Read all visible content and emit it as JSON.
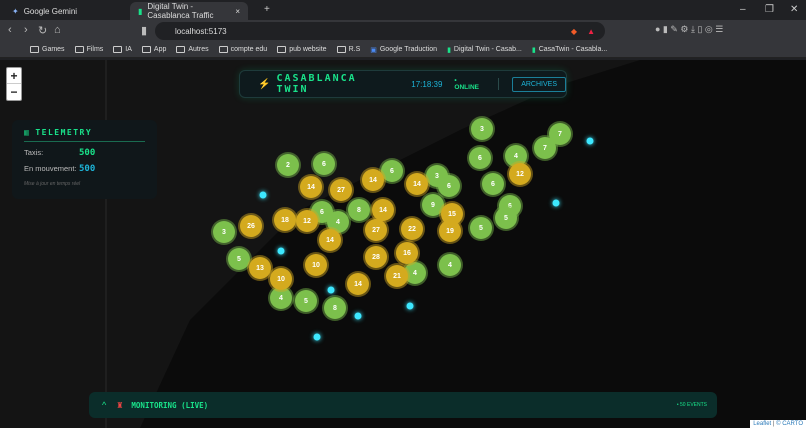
{
  "browser": {
    "tabs": [
      {
        "label": "Google Gemini"
      },
      {
        "label": "Digital Twin - Casablanca Traffic"
      }
    ],
    "url": "localhost:5173",
    "bookmarks": [
      "Games",
      "Films",
      "IA",
      "App",
      "Autres",
      "compte edu",
      "pub website",
      "R.S",
      "Google Traduction",
      "Digital Twin - Casab...",
      "CasaTwin - Casabla..."
    ]
  },
  "header": {
    "title": "CASABLANCA TWIN",
    "time": "17:18:39",
    "status": "• ONLINE",
    "archives": "ARCHIVES"
  },
  "zoom": {
    "in": "+",
    "out": "−"
  },
  "telemetry": {
    "title": "TELEMETRY",
    "taxis_label": "Taxis:",
    "taxis": "500",
    "moving_label": "En mouvement:",
    "moving": "500",
    "note": "Mise à jour en temps réel"
  },
  "clusters": {
    "green": [
      "3",
      "7",
      "7",
      "2",
      "6",
      "6",
      "4",
      "6",
      "3",
      "6",
      "6",
      "9",
      "6",
      "5",
      "5",
      "8",
      "6",
      "4",
      "3",
      "5",
      "4",
      "4",
      "4",
      "5",
      "8"
    ],
    "yellow": [
      "14",
      "27",
      "14",
      "14",
      "12",
      "14",
      "18",
      "12",
      "26",
      "14",
      "27",
      "22",
      "15",
      "19",
      "28",
      "16",
      "13",
      "10",
      "10",
      "21",
      "14"
    ]
  },
  "monitoring": {
    "title": "MONITORING (LIVE)",
    "events": "• 50 EVENTS"
  },
  "attribution": {
    "leaflet": "Leaflet",
    "carto": "© CARTO"
  },
  "colors": {
    "accent": "#19e28a",
    "cyan": "#1db4d8",
    "green_cluster": "#7cc04c",
    "yellow_cluster": "#d4aa1e"
  }
}
